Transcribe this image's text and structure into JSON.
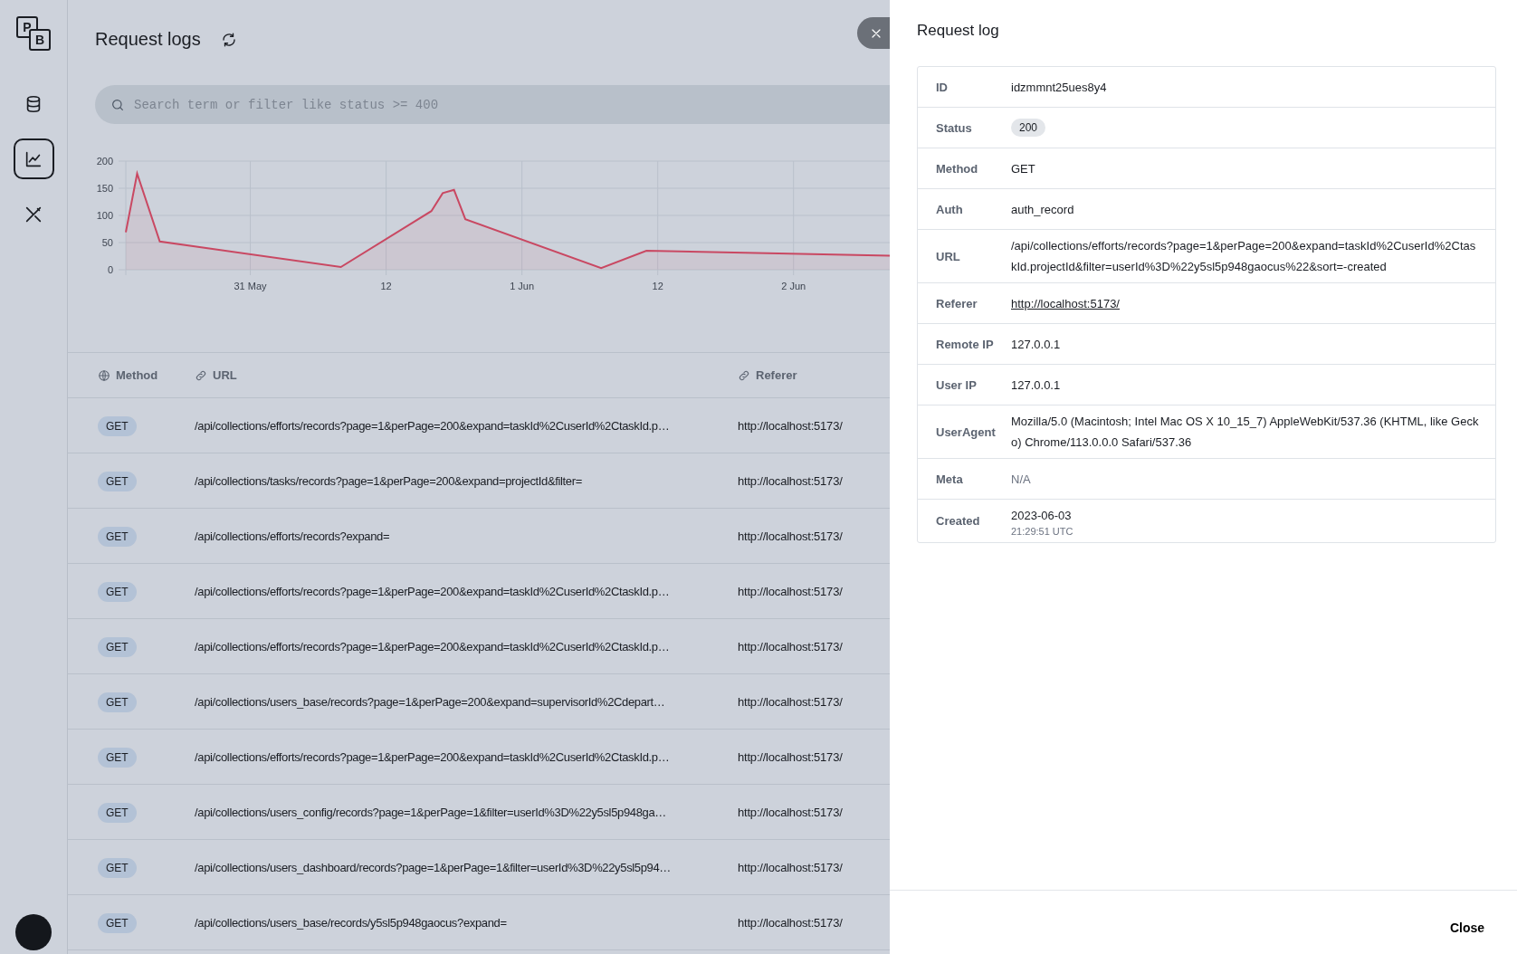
{
  "sidebar": {
    "logo": [
      "P",
      "B"
    ],
    "items": [
      {
        "kind": "database",
        "selected": false
      },
      {
        "kind": "chart",
        "selected": true
      },
      {
        "kind": "tools",
        "selected": false
      }
    ]
  },
  "header": {
    "title": "Request logs"
  },
  "search": {
    "placeholder": "Search term or filter like status >= 400"
  },
  "chart": {
    "chart_data": {
      "type": "area",
      "grid": true,
      "xlim": [
        "2023-05-30T13:00",
        "2023-06-02T08:30"
      ],
      "ylim": [
        0,
        200
      ],
      "yticks": [
        0,
        50,
        100,
        150,
        200
      ],
      "xticks": [
        {
          "value": "2023-05-31T00:00",
          "label": "31 May"
        },
        {
          "value": "2023-05-31T12:00",
          "label": "12"
        },
        {
          "value": "2023-06-01T00:00",
          "label": "1 Jun"
        },
        {
          "value": "2023-06-01T12:00",
          "label": "12"
        },
        {
          "value": "2023-06-02T00:00",
          "label": "2 Jun"
        }
      ],
      "x": [
        "2023-05-30T13:00",
        "2023-05-30T14:00",
        "2023-05-30T16:00",
        "2023-05-31T08:00",
        "2023-05-31T16:00",
        "2023-05-31T17:00",
        "2023-05-31T18:00",
        "2023-05-31T19:00",
        "2023-06-01T07:00",
        "2023-06-01T11:00",
        "2023-06-02T08:30"
      ],
      "series": [
        {
          "color": "#c94862",
          "values": [
            69,
            177,
            52,
            5,
            108,
            141,
            147,
            93,
            3,
            35,
            26
          ]
        }
      ]
    }
  },
  "table": {
    "columns": [
      {
        "label": "Method",
        "kind": "globe"
      },
      {
        "label": "URL",
        "kind": "link"
      },
      {
        "label": "Referer",
        "kind": "link"
      }
    ],
    "rows": [
      {
        "method": "GET",
        "url": "/api/collections/efforts/records?page=1&perPage=200&expand=taskId%2CuserId%2CtaskId.p…",
        "referer": "http://localhost:5173/"
      },
      {
        "method": "GET",
        "url": "/api/collections/tasks/records?page=1&perPage=200&expand=projectId&filter=",
        "referer": "http://localhost:5173/"
      },
      {
        "method": "GET",
        "url": "/api/collections/efforts/records?expand=",
        "referer": "http://localhost:5173/"
      },
      {
        "method": "GET",
        "url": "/api/collections/efforts/records?page=1&perPage=200&expand=taskId%2CuserId%2CtaskId.p…",
        "referer": "http://localhost:5173/"
      },
      {
        "method": "GET",
        "url": "/api/collections/efforts/records?page=1&perPage=200&expand=taskId%2CuserId%2CtaskId.p…",
        "referer": "http://localhost:5173/"
      },
      {
        "method": "GET",
        "url": "/api/collections/users_base/records?page=1&perPage=200&expand=supervisorId%2Cdepart…",
        "referer": "http://localhost:5173/"
      },
      {
        "method": "GET",
        "url": "/api/collections/efforts/records?page=1&perPage=200&expand=taskId%2CuserId%2CtaskId.p…",
        "referer": "http://localhost:5173/"
      },
      {
        "method": "GET",
        "url": "/api/collections/users_config/records?page=1&perPage=1&filter=userId%3D%22y5sl5p948ga…",
        "referer": "http://localhost:5173/"
      },
      {
        "method": "GET",
        "url": "/api/collections/users_dashboard/records?page=1&perPage=1&filter=userId%3D%22y5sl5p94…",
        "referer": "http://localhost:5173/"
      },
      {
        "method": "GET",
        "url": "/api/collections/users_base/records/y5sl5p948gaocus?expand=",
        "referer": "http://localhost:5173/"
      }
    ]
  },
  "detail": {
    "title": "Request log",
    "fields": [
      {
        "label": "ID",
        "kind": "text",
        "value": "idzmmnt25ues8y4"
      },
      {
        "label": "Status",
        "kind": "badge",
        "value": "200"
      },
      {
        "label": "Method",
        "kind": "text",
        "value": "GET"
      },
      {
        "label": "Auth",
        "kind": "text",
        "value": "auth_record"
      },
      {
        "label": "URL",
        "kind": "text",
        "value": "/api/collections/efforts/records?page=1&perPage=200&expand=taskId%2CuserId%2CtaskId.projectId&filter=userId%3D%22y5sl5p948gaocus%22&sort=-created"
      },
      {
        "label": "Referer",
        "kind": "link",
        "value": "http://localhost:5173/"
      },
      {
        "label": "Remote IP",
        "kind": "text",
        "value": "127.0.0.1"
      },
      {
        "label": "User IP",
        "kind": "text",
        "value": "127.0.0.1"
      },
      {
        "label": "UserAgent",
        "kind": "text",
        "value": "Mozilla/5.0 (Macintosh; Intel Mac OS X 10_15_7) AppleWebKit/537.36 (KHTML, like Gecko) Chrome/113.0.0.0 Safari/537.36"
      },
      {
        "label": "Meta",
        "kind": "muted",
        "value": "N/A"
      },
      {
        "label": "Created",
        "kind": "datetime",
        "value": "2023-06-03",
        "sub": "21:29:51 UTC"
      }
    ]
  },
  "footer": {
    "close": "Close"
  }
}
